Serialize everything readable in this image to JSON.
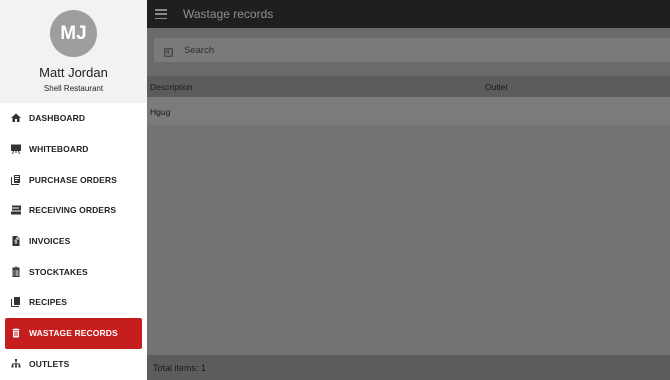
{
  "profile": {
    "initials": "MJ",
    "name": "Matt Jordan",
    "subtitle": "Shell Restaurant"
  },
  "nav": {
    "items": [
      {
        "label": "DASHBOARD",
        "icon": "home-icon"
      },
      {
        "label": "WHITEBOARD",
        "icon": "whiteboard-icon"
      },
      {
        "label": "PURCHASE ORDERS",
        "icon": "purchase-orders-icon"
      },
      {
        "label": "RECEIVING ORDERS",
        "icon": "receiving-orders-icon"
      },
      {
        "label": "INVOICES",
        "icon": "invoice-icon"
      },
      {
        "label": "STOCKTAKES",
        "icon": "stocktake-icon"
      },
      {
        "label": "RECIPES",
        "icon": "recipes-icon"
      },
      {
        "label": "WASTAGE RECORDS",
        "icon": "trash-icon",
        "active": true
      },
      {
        "label": "OUTLETS",
        "icon": "outlets-icon"
      }
    ]
  },
  "topbar": {
    "title": "Wastage records"
  },
  "search": {
    "placeholder": "Search",
    "value": ""
  },
  "table": {
    "columns": [
      "Description",
      "Outlet"
    ],
    "rows": [
      {
        "description": "Hgug",
        "outlet": ""
      }
    ]
  },
  "footer": {
    "total_label": "Total items: 1"
  },
  "colors": {
    "accent": "#c61d1d",
    "topbar": "#1f1f1f",
    "overlay": "#737373"
  }
}
